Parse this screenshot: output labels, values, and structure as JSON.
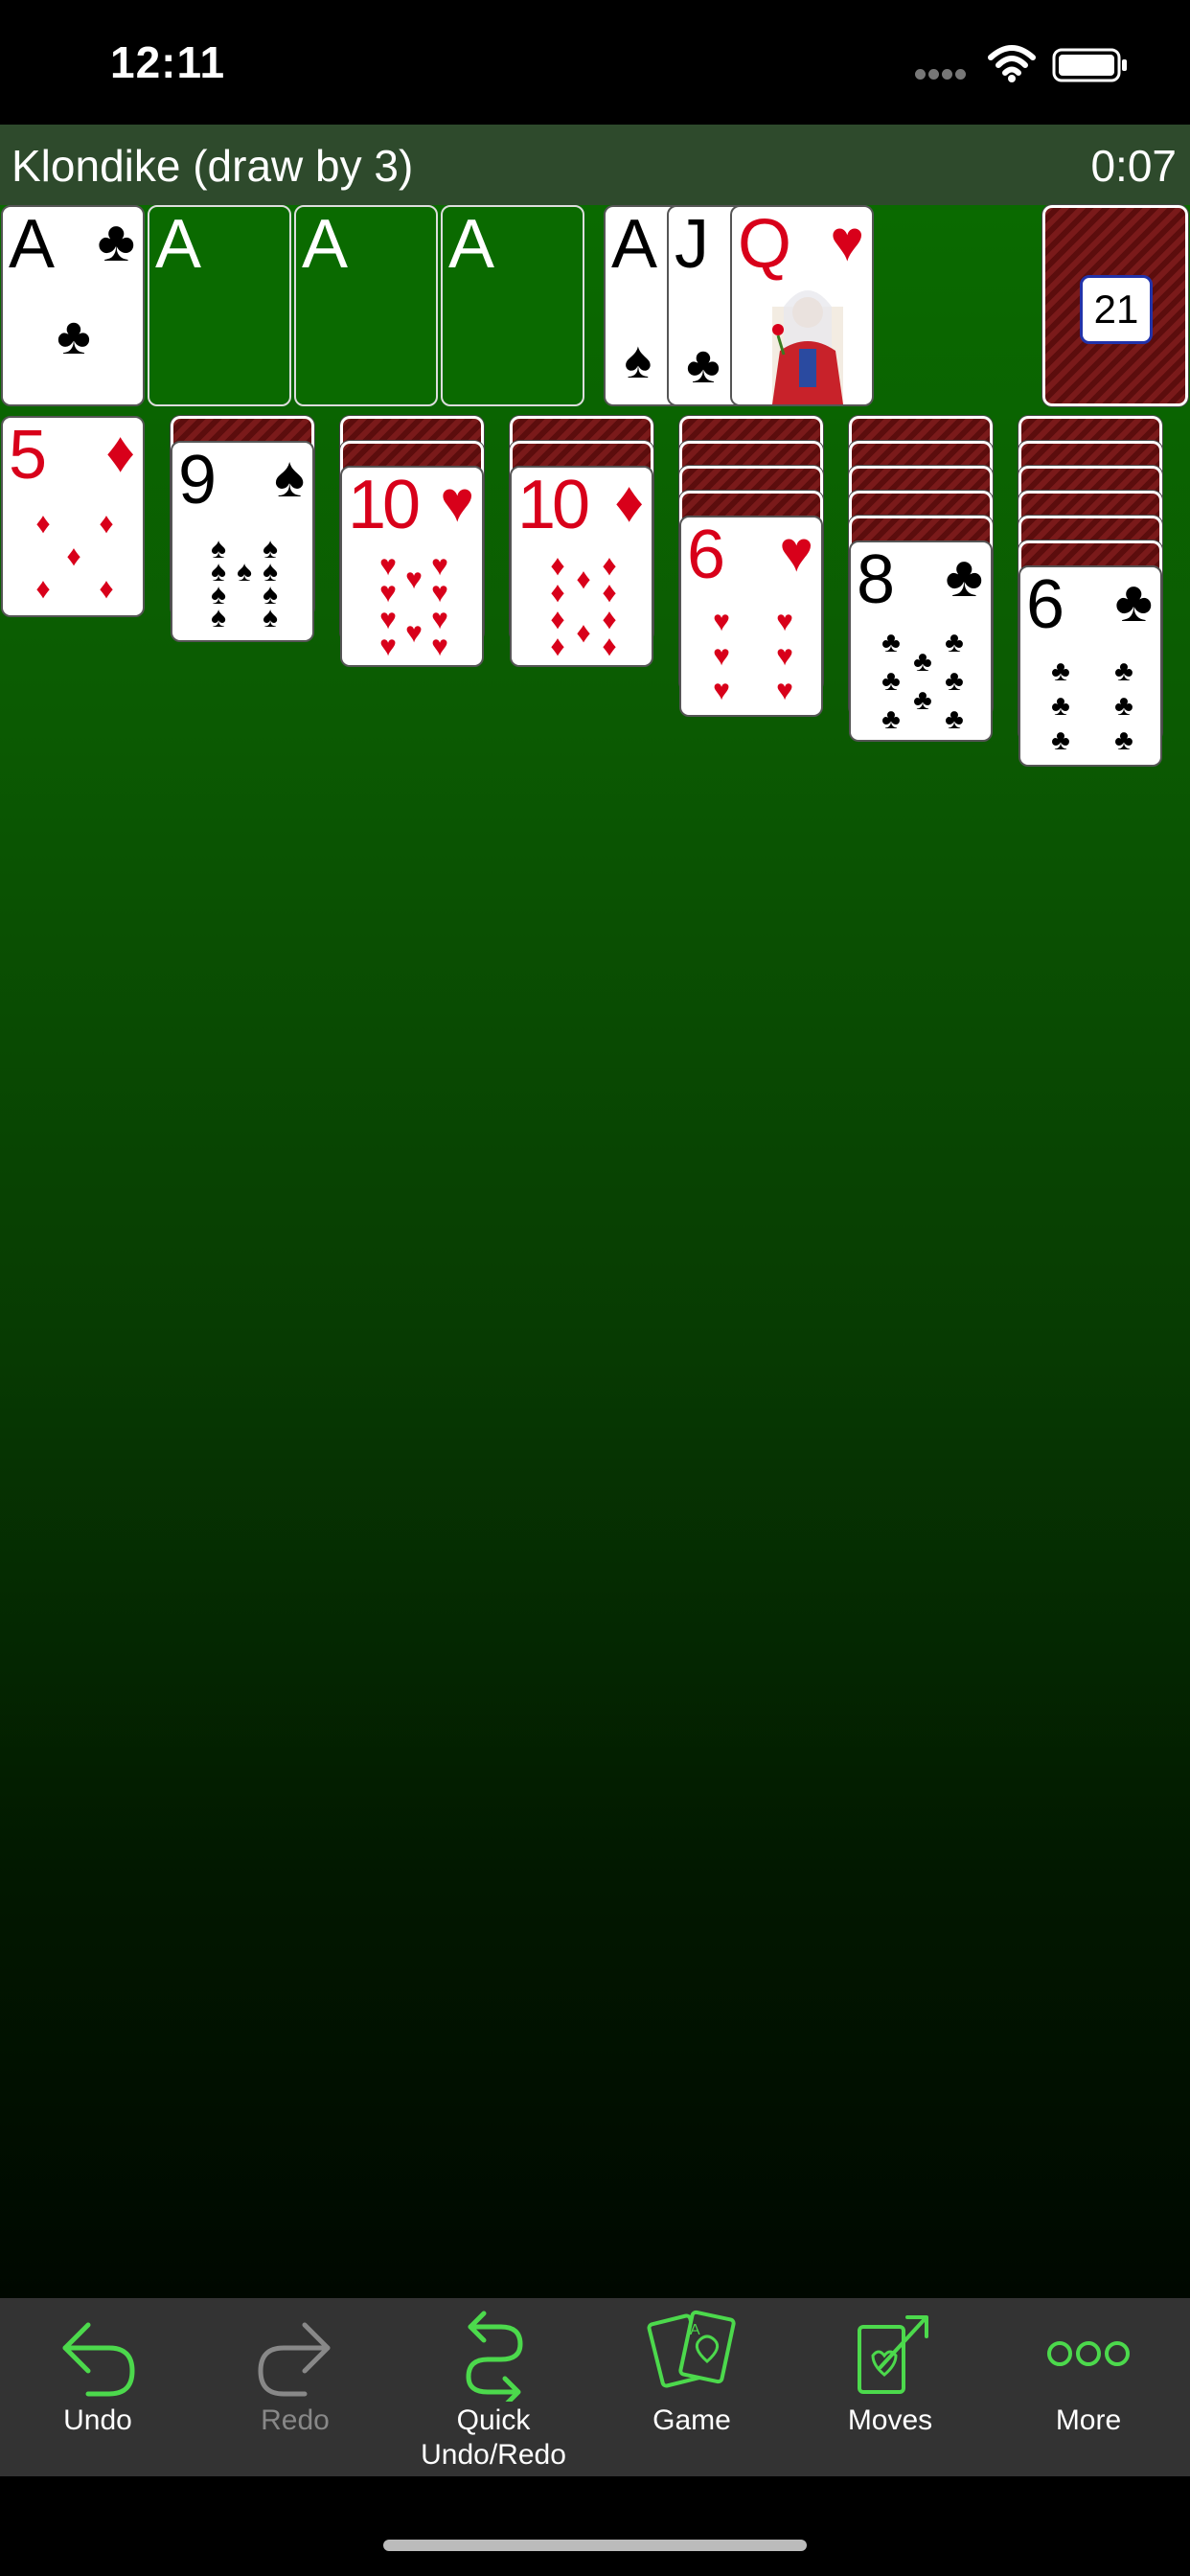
{
  "status": {
    "time": "12:11"
  },
  "header": {
    "title": "Klondike (draw by 3)",
    "timer": "0:07"
  },
  "foundations": [
    {
      "rank": "A",
      "suit": "♣",
      "color": "black",
      "empty": false
    },
    {
      "rank": "A",
      "empty": true
    },
    {
      "rank": "A",
      "empty": true
    },
    {
      "rank": "A",
      "empty": true
    }
  ],
  "waste": [
    {
      "rank": "A",
      "suit": "♠",
      "color": "black"
    },
    {
      "rank": "J",
      "suit": "♣",
      "color": "black"
    },
    {
      "rank": "Q",
      "suit": "♥",
      "color": "red"
    }
  ],
  "stock": {
    "count": "21"
  },
  "tableau": [
    {
      "hidden": 0,
      "top": {
        "rank": "5",
        "suit": "♦",
        "color": "red"
      }
    },
    {
      "hidden": 1,
      "top": {
        "rank": "9",
        "suit": "♠",
        "color": "black"
      }
    },
    {
      "hidden": 2,
      "top": {
        "rank": "10",
        "suit": "♥",
        "color": "red"
      }
    },
    {
      "hidden": 2,
      "top": {
        "rank": "10",
        "suit": "♦",
        "color": "red"
      }
    },
    {
      "hidden": 4,
      "top": {
        "rank": "6",
        "suit": "♥",
        "color": "red"
      }
    },
    {
      "hidden": 5,
      "top": {
        "rank": "8",
        "suit": "♣",
        "color": "black"
      }
    },
    {
      "hidden": 6,
      "top": {
        "rank": "6",
        "suit": "♣",
        "color": "black"
      }
    }
  ],
  "toolbar": {
    "undo": "Undo",
    "redo": "Redo",
    "quick_line1": "Quick",
    "quick_line2": "Undo/Redo",
    "game": "Game",
    "moves": "Moves",
    "more": "More",
    "accent": "#4cd94c",
    "disabled_color": "#888888"
  }
}
